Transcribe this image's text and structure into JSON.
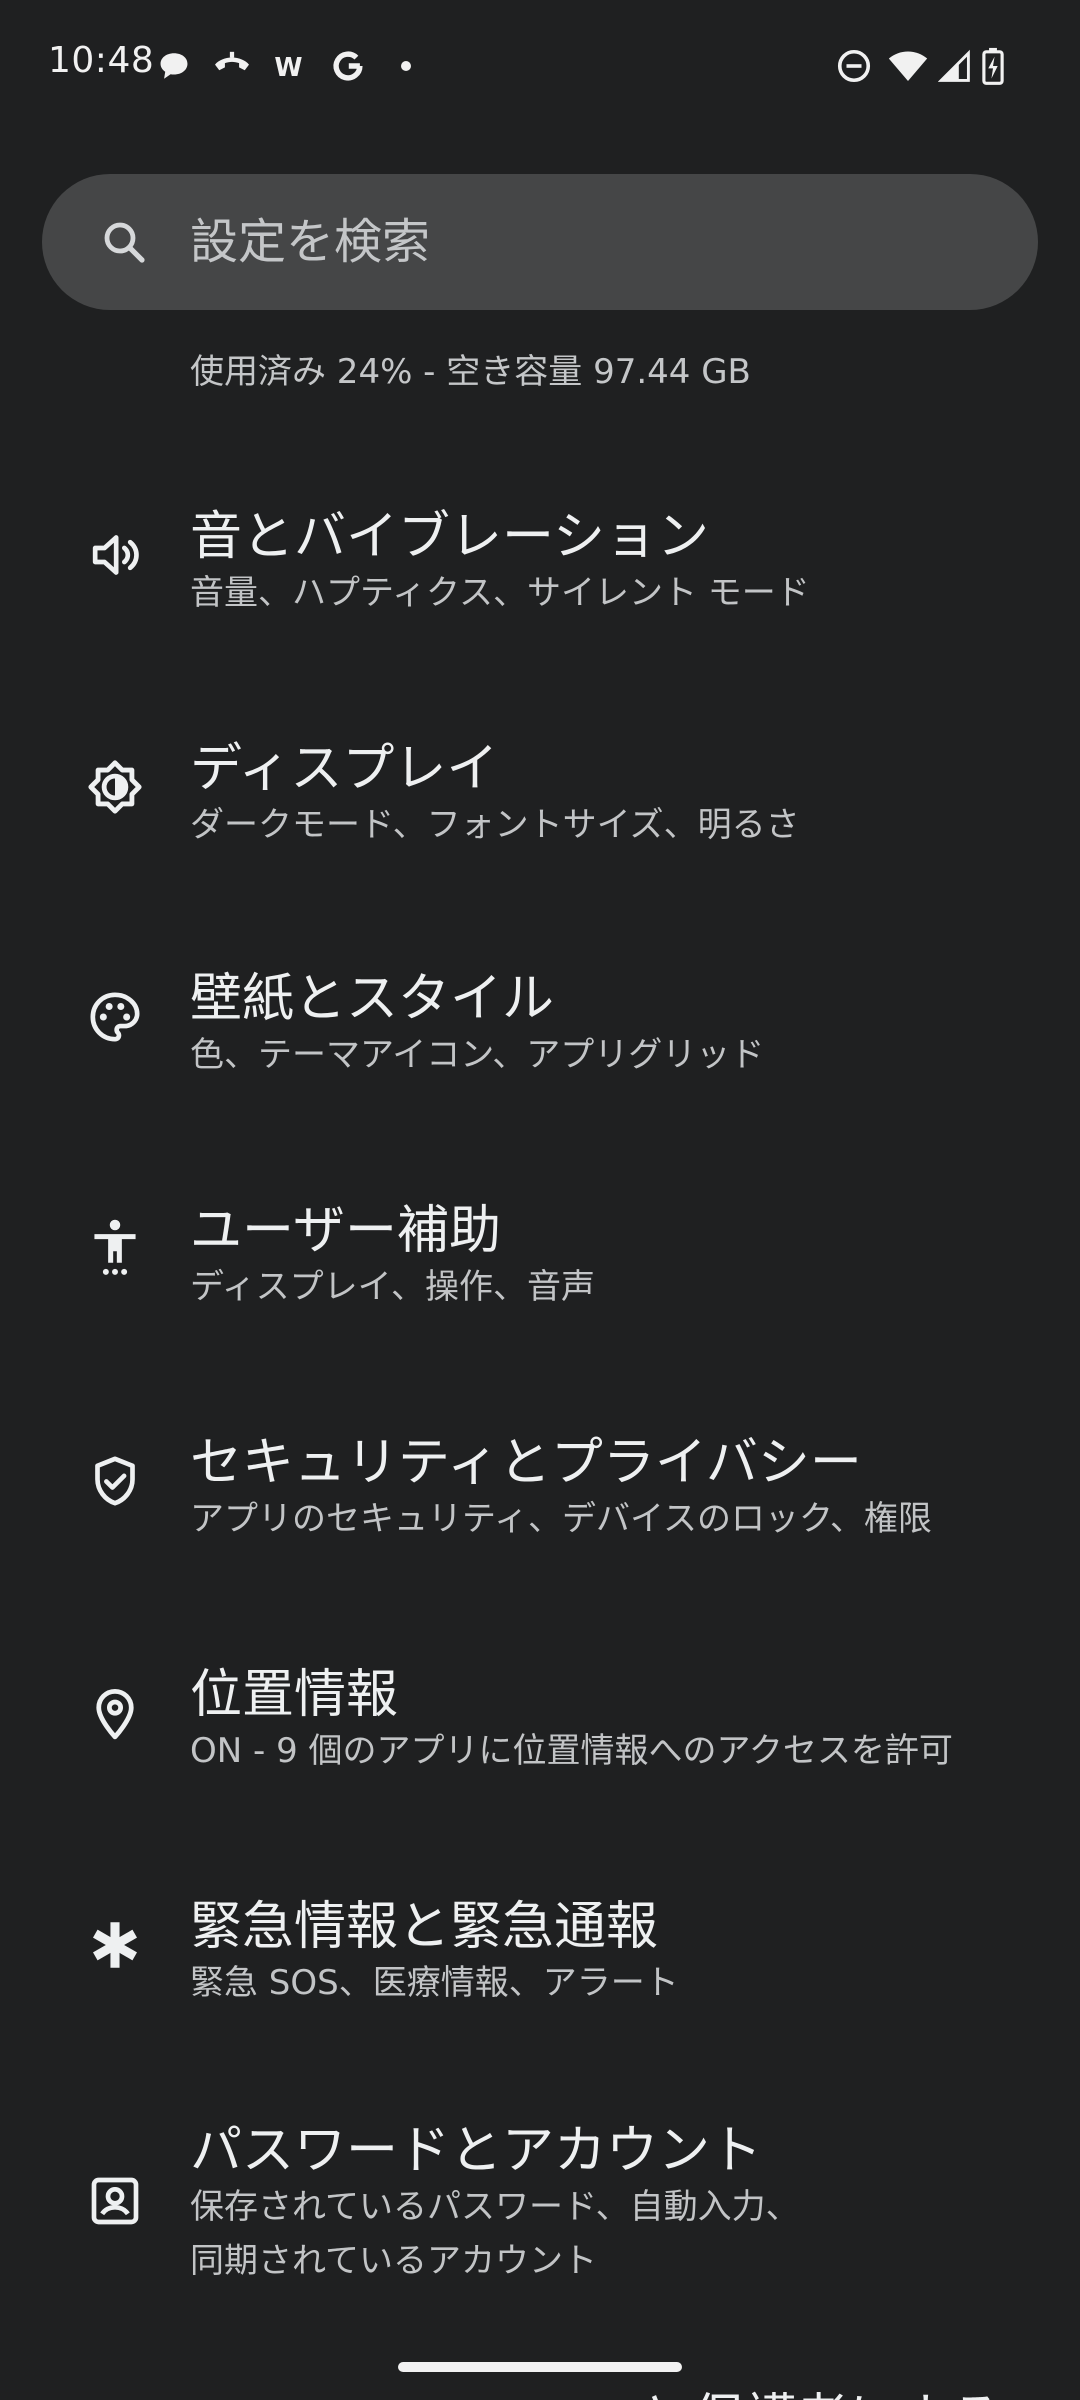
{
  "status_bar": {
    "time": "10:48",
    "notification_icons": [
      "chat-bubble-icon",
      "call-icon",
      "w-app-icon",
      "google-g-icon",
      "more-dot-icon"
    ],
    "system_icons": [
      "dnd-icon",
      "wifi-icon",
      "signal-icon",
      "battery-charging-icon"
    ]
  },
  "search": {
    "placeholder": "設定を検索"
  },
  "storage_summary": "使用済み 24% - 空き容量 97.44 GB",
  "settings": [
    {
      "icon": "volume-icon",
      "title": "音とバイブレーション",
      "subtitle": "音量、ハプティクス、サイレント モード"
    },
    {
      "icon": "brightness-icon",
      "title": "ディスプレイ",
      "subtitle": "ダークモード、フォントサイズ、明るさ"
    },
    {
      "icon": "palette-icon",
      "title": "壁紙とスタイル",
      "subtitle": "色、テーマアイコン、アプリグリッド"
    },
    {
      "icon": "accessibility-icon",
      "title": "ユーザー補助",
      "subtitle": "ディスプレイ、操作、音声"
    },
    {
      "icon": "shield-check-icon",
      "title": "セキュリティとプライバシー",
      "subtitle": "アプリのセキュリティ、デバイスのロック、権限"
    },
    {
      "icon": "location-pin-icon",
      "title": "位置情報",
      "subtitle": "ON - 9 個のアプリに位置情報へのアクセスを許可"
    },
    {
      "icon": "asterisk-icon",
      "title": "緊急情報と緊急通報",
      "subtitle": "緊急 SOS、医療情報、アラート"
    },
    {
      "icon": "account-box-icon",
      "title": "パスワードとアカウント",
      "subtitle_line1": "保存されているパスワード、自動入力、",
      "subtitle_line2": "同期されているアカウント"
    }
  ],
  "partial_next_title": "と保護者による",
  "colors": {
    "background": "#1f2021",
    "search_bar": "#454647",
    "primary_text": "#eef0f1",
    "secondary_text": "#c2c4c6"
  }
}
